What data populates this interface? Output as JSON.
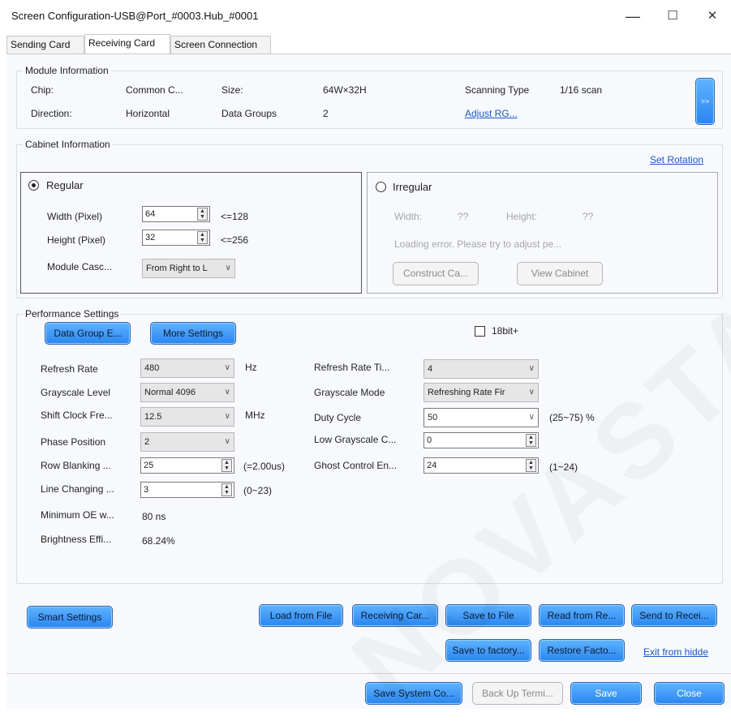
{
  "window": {
    "title": "Screen Configuration-USB@Port_#0003.Hub_#0001",
    "minimize_glyph": "—",
    "maximize_glyph": "☐",
    "close_glyph": "✕"
  },
  "tabs": [
    "Sending Card",
    "Receiving Card",
    "Screen Connection"
  ],
  "module_info": {
    "legend": "Module Information",
    "chip_label": "Chip:",
    "chip_value": "Common C...",
    "size_label": "Size:",
    "size_value": "64W×32H",
    "scanning_label": "Scanning Type",
    "scanning_value": "1/16 scan",
    "direction_label": "Direction:",
    "direction_value": "Horizontal",
    "data_groups_label": "Data Groups",
    "data_groups_value": "2",
    "adjust_link": "Adjust RG...",
    "expand_button": ">>"
  },
  "cabinet": {
    "legend": "Cabinet Information",
    "set_rotation": "Set Rotation",
    "regular": {
      "label": "Regular",
      "width_label": "Width (Pixel)",
      "width_value": "64",
      "width_limit": "<=128",
      "height_label": "Height (Pixel)",
      "height_value": "32",
      "height_limit": "<=256",
      "cascade_label": "Module Casc...",
      "cascade_value": "From Right to L"
    },
    "irregular": {
      "label": "Irregular",
      "width_label": "Width:",
      "width_value": "??",
      "height_label": "Height:",
      "height_value": "??",
      "error": "Loading error. Please try to adjust pe...",
      "construct_button": "Construct Ca...",
      "view_button": "View Cabinet"
    }
  },
  "performance": {
    "legend": "Performance Settings",
    "data_group_button": "Data Group E...",
    "more_settings_button": "More Settings",
    "bit18_label": "18bit+",
    "refresh_rate_label": "Refresh Rate",
    "refresh_rate_value": "480",
    "refresh_rate_unit": "Hz",
    "grayscale_level_label": "Grayscale Level",
    "grayscale_level_value": "Normal 4096",
    "shift_clock_label": "Shift Clock Fre...",
    "shift_clock_value": "12.5",
    "shift_clock_unit": "MHz",
    "phase_label": "Phase Position",
    "phase_value": "2",
    "row_blanking_label": "Row Blanking ...",
    "row_blanking_value": "25",
    "row_blanking_note": "(=2.00us)",
    "line_changing_label": "Line Changing ...",
    "line_changing_value": "3",
    "line_changing_note": "(0~23)",
    "min_oe_label": "Minimum OE w...",
    "min_oe_value": "80 ns",
    "brightness_label": "Brightness Effi...",
    "brightness_value": "68.24%",
    "refresh_times_label": "Refresh Rate Ti...",
    "refresh_times_value": "4",
    "grayscale_mode_label": "Grayscale Mode",
    "grayscale_mode_value": "Refreshing Rate Fir",
    "duty_label": "Duty Cycle",
    "duty_value": "50",
    "duty_note": "(25~75) %",
    "low_gray_label": "Low Grayscale C...",
    "low_gray_value": "0",
    "ghost_label": "Ghost Control En...",
    "ghost_value": "24",
    "ghost_note": "(1~24)"
  },
  "actions": {
    "smart_settings": "Smart Settings",
    "load_from_file": "Load from File",
    "receiving_card": "Receiving Car...",
    "save_to_file": "Save to File",
    "read_from": "Read from Re...",
    "send_to": "Send to Recei...",
    "save_to_factory": "Save to factory...",
    "restore_factory": "Restore Facto...",
    "exit_hidden": "Exit from hidde"
  },
  "footer": {
    "save_system": "Save System Co...",
    "back_up": "Back Up Termi...",
    "save": "Save",
    "close": "Close"
  },
  "watermark": "NOVASTAR TECH"
}
